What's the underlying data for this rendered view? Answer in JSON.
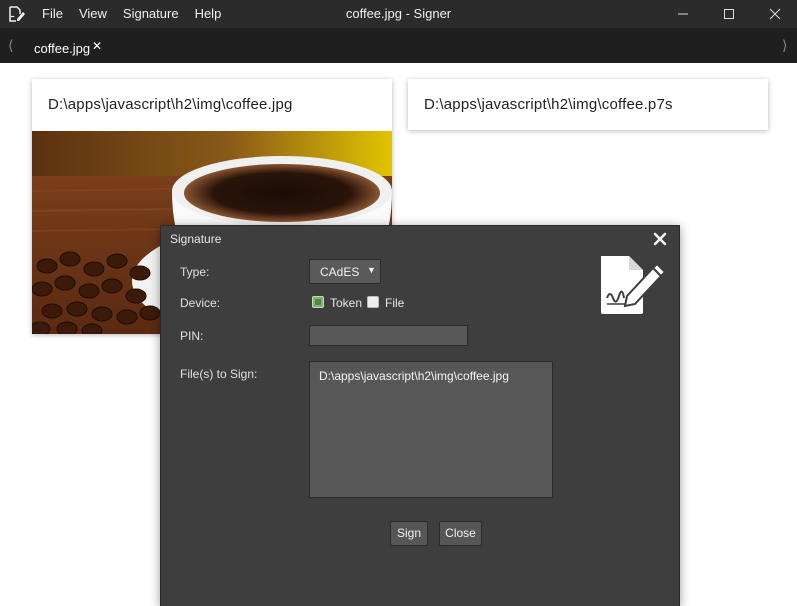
{
  "window": {
    "title": "coffee.jpg - Signer",
    "menu": [
      "File",
      "View",
      "Signature",
      "Help"
    ]
  },
  "tabs": {
    "active_label": "coffee.jpg"
  },
  "cards": {
    "source_path": "D:\\apps\\javascript\\h2\\img\\coffee.jpg",
    "output_path": "D:\\apps\\javascript\\h2\\img\\coffee.p7s"
  },
  "dialog": {
    "title": "Signature",
    "type_label": "Type:",
    "type_value": "CAdES",
    "device_label": "Device:",
    "device_options": {
      "token": "Token",
      "file": "File"
    },
    "device_selected": "Token",
    "pin_label": "PIN:",
    "pin_value": "",
    "files_label": "File(s) to Sign:",
    "files_value": "D:\\apps\\javascript\\h2\\img\\coffee.jpg",
    "sign_button": "Sign",
    "close_button": "Close"
  },
  "icons": {
    "app": "pen-sign-icon",
    "dialog_close": "close-icon",
    "signature": "document-signature-icon"
  },
  "colors": {
    "titlebar": "#2b2b2b",
    "tabstrip": "#1f1f1f",
    "dialog_bg": "#3e3e3e",
    "checkbox_checked": "#7fb86a"
  }
}
